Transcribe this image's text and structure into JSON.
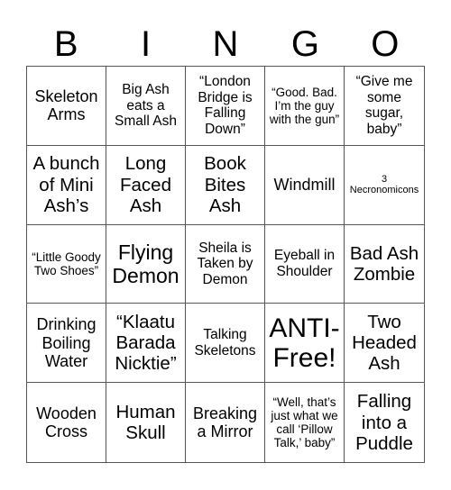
{
  "header": [
    "B",
    "I",
    "N",
    "G",
    "O"
  ],
  "cells": [
    {
      "text": "Skeleton Arms",
      "size": "s-lg"
    },
    {
      "text": "Big Ash eats a Small Ash",
      "size": "s-md"
    },
    {
      "text": "“London Bridge is Falling Down”",
      "size": "s-md"
    },
    {
      "text": "“Good. Bad. I’m the guy with the gun”",
      "size": "s-sm"
    },
    {
      "text": "“Give me some sugar, baby”",
      "size": "s-md"
    },
    {
      "text": "A bunch of Mini Ash’s",
      "size": "s-xl"
    },
    {
      "text": "Long Faced Ash",
      "size": "s-xl"
    },
    {
      "text": "Book Bites Ash",
      "size": "s-xl"
    },
    {
      "text": "Windmill",
      "size": "s-lg"
    },
    {
      "text": "3 Necronomicons",
      "size": "s-xs"
    },
    {
      "text": "“Little Goody Two Shoes”",
      "size": "s-sm"
    },
    {
      "text": "Flying Demon",
      "size": "s-xxl"
    },
    {
      "text": "Sheila is Taken by Demon",
      "size": "s-md"
    },
    {
      "text": "Eyeball in Shoulder",
      "size": "s-md"
    },
    {
      "text": "Bad Ash Zombie",
      "size": "s-xl"
    },
    {
      "text": "Drinking Boiling Water",
      "size": "s-lg"
    },
    {
      "text": "“Klaatu Barada Nicktie”",
      "size": "s-xl"
    },
    {
      "text": "Talking Skeletons",
      "size": "s-md"
    },
    {
      "text": "ANTI-Free!",
      "size": "s-free"
    },
    {
      "text": "Two Headed Ash",
      "size": "s-xl"
    },
    {
      "text": "Wooden Cross",
      "size": "s-lg"
    },
    {
      "text": "Human Skull",
      "size": "s-xl"
    },
    {
      "text": "Breaking a Mirror",
      "size": "s-lg"
    },
    {
      "text": "“Well, that’s just what we call ‘Pillow Talk,’ baby”",
      "size": "s-sm"
    },
    {
      "text": "Falling into a Puddle",
      "size": "s-xl"
    }
  ]
}
